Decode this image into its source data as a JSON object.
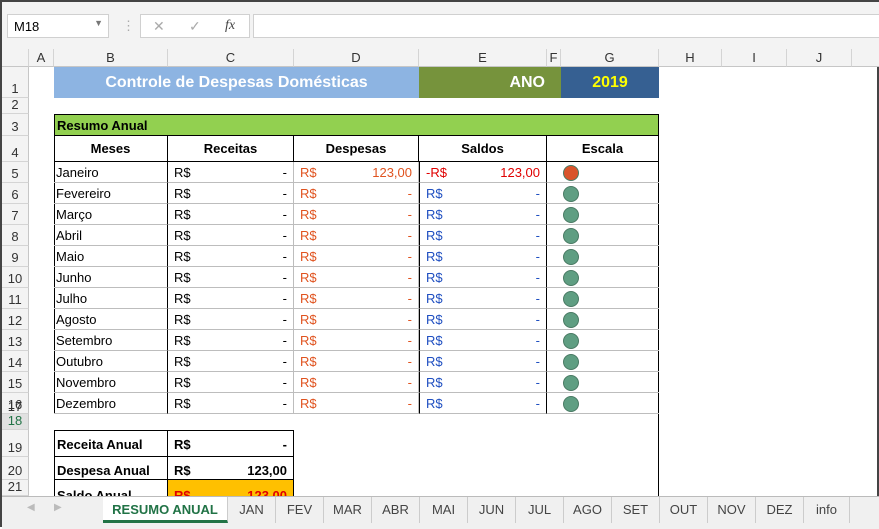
{
  "namebox": "M18",
  "formula_bar": {
    "cancel_icon": "✕",
    "enter_icon": "✓",
    "fx_label": "fx",
    "value": ""
  },
  "columns": [
    "A",
    "B",
    "C",
    "D",
    "E",
    "F",
    "G",
    "H",
    "I",
    "J"
  ],
  "title": "Controle de Despesas Domésticas",
  "ano_label": "ANO",
  "ano_value": "2019",
  "section_title": "Resumo Anual",
  "headers": [
    "Meses",
    "Receitas",
    "Despesas",
    "Saldos",
    "Escala"
  ],
  "currency": "R$",
  "months": [
    {
      "name": "Janeiro",
      "receita": "-",
      "despesa": "123,00",
      "saldo_cur": "-R$",
      "saldo": "123,00",
      "escala": "#d9542b",
      "negative": true
    },
    {
      "name": "Fevereiro",
      "receita": "-",
      "despesa": "-",
      "saldo_cur": "R$",
      "saldo": "-",
      "escala": "#5f9e82"
    },
    {
      "name": "Março",
      "receita": "-",
      "despesa": "-",
      "saldo_cur": "R$",
      "saldo": "-",
      "escala": "#5f9e82"
    },
    {
      "name": "Abril",
      "receita": "-",
      "despesa": "-",
      "saldo_cur": "R$",
      "saldo": "-",
      "escala": "#5f9e82"
    },
    {
      "name": "Maio",
      "receita": "-",
      "despesa": "-",
      "saldo_cur": "R$",
      "saldo": "-",
      "escala": "#5f9e82"
    },
    {
      "name": "Junho",
      "receita": "-",
      "despesa": "-",
      "saldo_cur": "R$",
      "saldo": "-",
      "escala": "#5f9e82"
    },
    {
      "name": "Julho",
      "receita": "-",
      "despesa": "-",
      "saldo_cur": "R$",
      "saldo": "-",
      "escala": "#5f9e82"
    },
    {
      "name": "Agosto",
      "receita": "-",
      "despesa": "-",
      "saldo_cur": "R$",
      "saldo": "-",
      "escala": "#5f9e82"
    },
    {
      "name": "Setembro",
      "receita": "-",
      "despesa": "-",
      "saldo_cur": "R$",
      "saldo": "-",
      "escala": "#5f9e82"
    },
    {
      "name": "Outubro",
      "receita": "-",
      "despesa": "-",
      "saldo_cur": "R$",
      "saldo": "-",
      "escala": "#5f9e82"
    },
    {
      "name": "Novembro",
      "receita": "-",
      "despesa": "-",
      "saldo_cur": "R$",
      "saldo": "-",
      "escala": "#5f9e82"
    },
    {
      "name": "Dezembro",
      "receita": "-",
      "despesa": "-",
      "saldo_cur": "R$",
      "saldo": "-",
      "escala": "#5f9e82"
    }
  ],
  "totals": [
    {
      "label": "Receita Anual",
      "cur": "R$",
      "value": "-"
    },
    {
      "label": "Despesa Anual",
      "cur": "R$",
      "value": "123,00"
    },
    {
      "label": "Saldo Anual",
      "cur": "R$",
      "value": "123,00"
    }
  ],
  "sheet_tabs": [
    "RESUMO ANUAL",
    "JAN",
    "FEV",
    "MAR",
    "ABR",
    "MAI",
    "JUN",
    "JUL",
    "AGO",
    "SET",
    "OUT",
    "NOV",
    "DEZ",
    "info"
  ],
  "active_tab": "RESUMO ANUAL",
  "colors": {
    "title_bg": "#8db4e2",
    "ano_bg": "#76933c",
    "year_bg": "#366092",
    "year_text": "#ffff00",
    "section_bg": "#92d050",
    "saldo_bg": "#ffc000",
    "despesa_text": "#e0531f",
    "saldo_text": "#1f4fc1",
    "negative_text": "#e00000"
  }
}
